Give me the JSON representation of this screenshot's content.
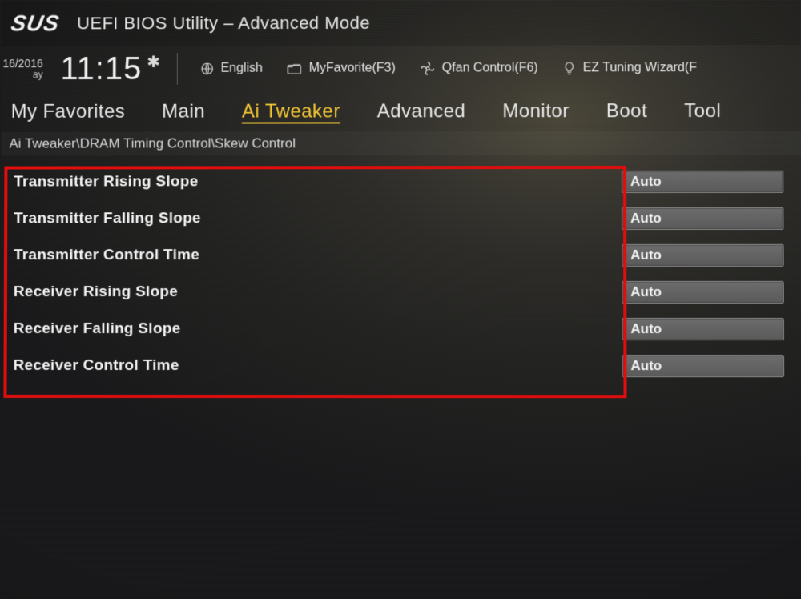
{
  "brand": {
    "logo_text": "SUS",
    "utility_title": "UEFI BIOS Utility – Advanced Mode"
  },
  "info": {
    "date_line1": "16/2016",
    "date_line2": "ay",
    "clock": "11:15",
    "language_label": "English",
    "favorite_label": "MyFavorite(F3)",
    "qfan_label": "Qfan Control(F6)",
    "tuning_label": "EZ Tuning Wizard(F"
  },
  "tabs": [
    {
      "label": "My Favorites",
      "active": false
    },
    {
      "label": "Main",
      "active": false
    },
    {
      "label": "Ai Tweaker",
      "active": true
    },
    {
      "label": "Advanced",
      "active": false
    },
    {
      "label": "Monitor",
      "active": false
    },
    {
      "label": "Boot",
      "active": false
    },
    {
      "label": "Tool",
      "active": false
    }
  ],
  "breadcrumb": "Ai Tweaker\\DRAM Timing Control\\Skew Control",
  "settings": [
    {
      "label": "Transmitter Rising Slope",
      "value": "Auto"
    },
    {
      "label": "Transmitter Falling Slope",
      "value": "Auto"
    },
    {
      "label": "Transmitter Control Time",
      "value": "Auto"
    },
    {
      "label": "Receiver Rising Slope",
      "value": "Auto"
    },
    {
      "label": "Receiver Falling Slope",
      "value": "Auto"
    },
    {
      "label": "Receiver Control Time",
      "value": "Auto"
    }
  ]
}
